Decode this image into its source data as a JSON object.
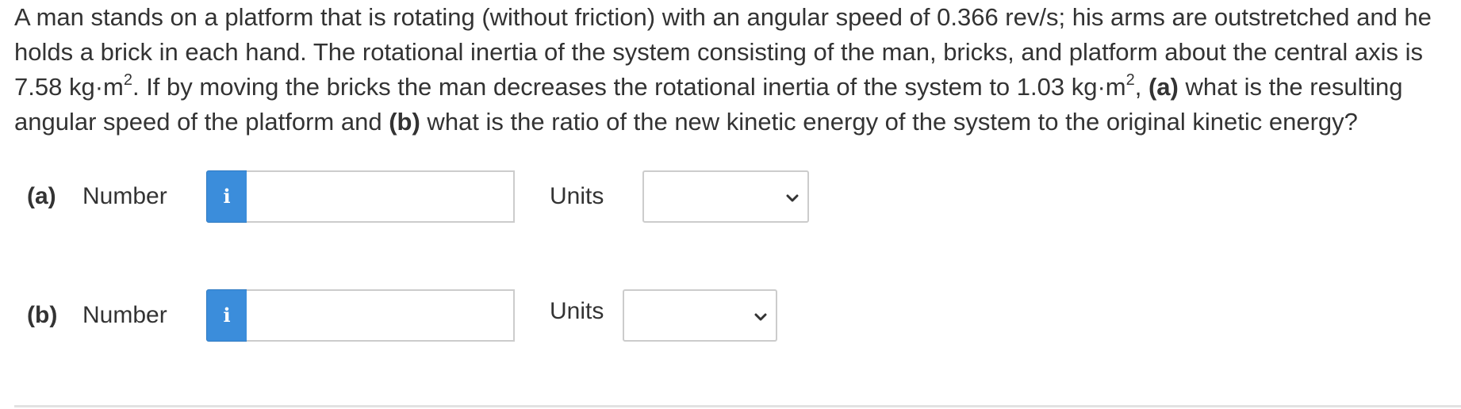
{
  "question": {
    "part1": "A man stands on a platform that is rotating (without friction) with an angular speed of 0.366 rev/s; his arms are outstretched and he holds a brick in each hand. The rotational inertia of the system consisting of the man, bricks, and platform about the central axis is 7.58 kg·m",
    "exp": "2",
    "part2": ". If by moving the bricks the man decreases the rotational inertia of the system to 1.03 kg·m",
    "exp2": "2",
    "part3": ", ",
    "a_label": "(a)",
    "part4": " what is the resulting angular speed of the platform and ",
    "b_label": "(b)",
    "part5": " what is the ratio of the new kinetic energy of the system to the original kinetic energy?"
  },
  "answers": [
    {
      "part": "(a)",
      "number_label": "Number",
      "info_icon": "i",
      "value": "",
      "units_label": "Units",
      "units_selected": ""
    },
    {
      "part": "(b)",
      "number_label": "Number",
      "info_icon": "i",
      "value": "",
      "units_label": "Units",
      "units_selected": ""
    }
  ],
  "colors": {
    "info_button": "#3b8ddb",
    "text": "#333333",
    "border": "#cccccc"
  },
  "icons": {
    "info": "info-icon",
    "dropdown": "chevron-down-icon"
  }
}
